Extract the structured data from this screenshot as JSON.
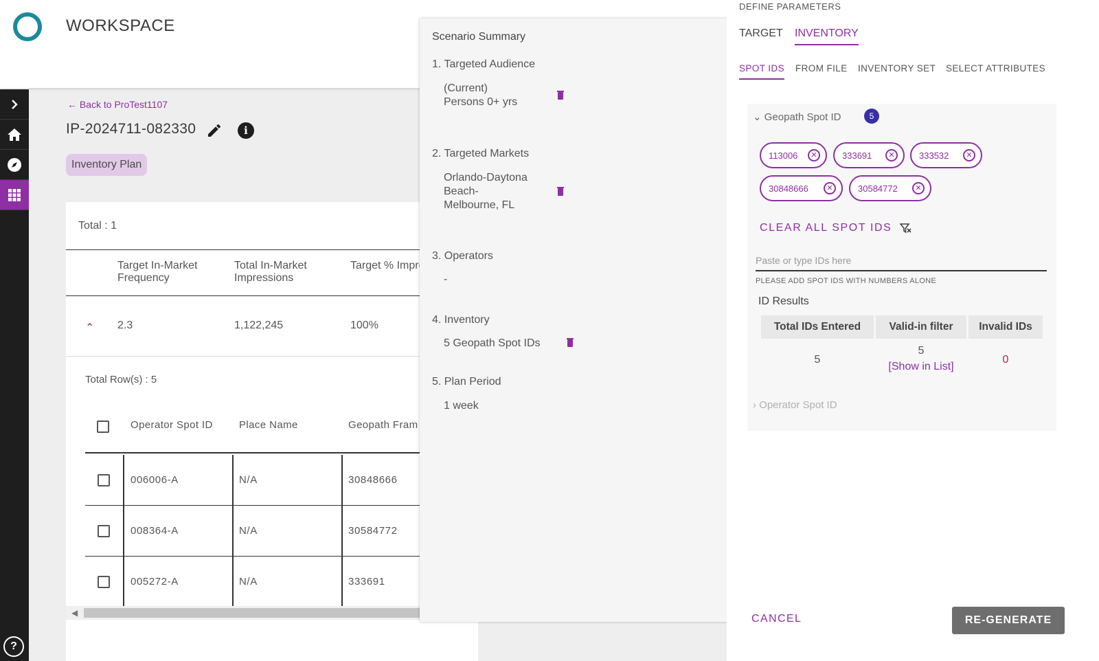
{
  "header": {
    "title": "WORKSPACE"
  },
  "rail": {
    "icons": [
      "chevron-right-icon",
      "home-icon",
      "compass-icon",
      "grid-icon",
      "help-icon"
    ],
    "help_label": "?"
  },
  "plan": {
    "back_link": "Back to ProTest1107",
    "id": "IP-2024711-082330",
    "chip": "Inventory Plan",
    "total": "Total : 1",
    "columns": [
      "Target In-Market Frequency",
      "Total In-Market Impressions",
      "Target % Impression C"
    ],
    "row": {
      "frequency": "2.3",
      "impressions": "1,122,245",
      "target_pct": "100%"
    },
    "total_rows": "Total Row(s) : 5",
    "sub_columns": [
      "Operator Spot ID",
      "Place Name",
      "Geopath Fram"
    ],
    "sub_rows": [
      {
        "operator_spot_id": "006006-A",
        "place_name": "N/A",
        "geopath_frame": "30848666"
      },
      {
        "operator_spot_id": "008364-A",
        "place_name": "N/A",
        "geopath_frame": "30584772"
      },
      {
        "operator_spot_id": "005272-A",
        "place_name": "N/A",
        "geopath_frame": "333691"
      }
    ]
  },
  "summary": {
    "title": "Scenario Summary",
    "sections": [
      {
        "heading": "1. Targeted Audience",
        "value_lines": [
          "(Current)",
          "Persons 0+ yrs"
        ]
      },
      {
        "heading": "2. Targeted Markets",
        "value_lines": [
          "Orlando-Daytona",
          "Beach-",
          "Melbourne, FL"
        ]
      },
      {
        "heading": "3. Operators",
        "value_lines": [
          "-"
        ]
      },
      {
        "heading": "4. Inventory",
        "value_lines": [
          "5 Geopath Spot IDs"
        ]
      },
      {
        "heading": "5. Plan Period",
        "value_lines": [
          "1 week"
        ]
      }
    ]
  },
  "params": {
    "title": "DEFINE PARAMETERS",
    "tabs": [
      "TARGET",
      "INVENTORY"
    ],
    "active_tab": "INVENTORY",
    "sub_tabs": [
      "SPOT IDS",
      "FROM FILE",
      "INVENTORY SET",
      "SELECT ATTRIBUTES"
    ],
    "active_sub_tab": "SPOT IDS",
    "group_label": "Geopath Spot ID",
    "group_count": "5",
    "spot_ids": [
      "113006",
      "333691",
      "333532",
      "30848666",
      "30584772"
    ],
    "clear_all": "CLEAR ALL SPOT IDS",
    "input_placeholder": "Paste or type IDs here",
    "hint": "PLEASE ADD SPOT IDS WITH NUMBERS ALONE",
    "results_title": "ID Results",
    "results_headers": [
      "Total IDs Entered",
      "Valid-in filter",
      "Invalid IDs"
    ],
    "results": {
      "total": "5",
      "valid": "5",
      "show_in_list": "[Show in List]",
      "invalid": "0"
    },
    "operator_group_label": "Operator Spot ID",
    "cancel": "CANCEL",
    "regenerate": "RE-GENERATE"
  },
  "colors": {
    "accent": "#8e2fa3",
    "logo": "#1a8a9a",
    "badge": "#3730a3",
    "invalid": "#c2185b"
  }
}
